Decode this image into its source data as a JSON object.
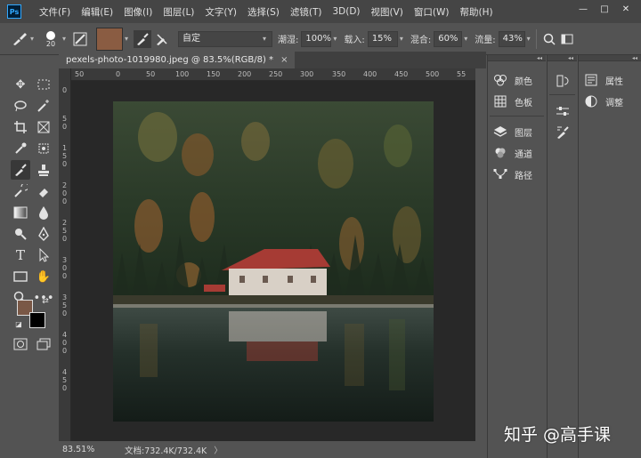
{
  "menubar": {
    "logo": "Ps",
    "items": [
      "文件(F)",
      "编辑(E)",
      "图像(I)",
      "图层(L)",
      "文字(Y)",
      "选择(S)",
      "滤镜(T)",
      "3D(D)",
      "视图(V)",
      "窗口(W)",
      "帮助(H)"
    ],
    "window_controls": [
      "—",
      "□",
      "✕"
    ]
  },
  "options": {
    "brush_size": "20",
    "brush_color": "#8a5c42",
    "mode_value": "自定",
    "opacity_label": "潮湿:",
    "opacity_value": "100%",
    "load_label": "载入:",
    "load_value": "15%",
    "mix_label": "混合:",
    "mix_value": "60%",
    "flow_label": "流量:",
    "flow_value": "43%"
  },
  "document": {
    "tab_title": "pexels-photo-1019980.jpeg @ 83.5%(RGB/8) *",
    "tab_close": "×"
  },
  "rulers": {
    "h_labels": [
      "50",
      "0",
      "50",
      "100",
      "150",
      "200",
      "250",
      "300",
      "350",
      "400",
      "450",
      "500",
      "55"
    ],
    "v_labels": [
      "0",
      "5",
      "0",
      "1",
      "5",
      "0",
      "2",
      "0",
      "0",
      "2",
      "5",
      "0",
      "3",
      "0",
      "0",
      "3",
      "5",
      "0",
      "4",
      "0",
      "0",
      "4",
      "5",
      "0"
    ]
  },
  "status": {
    "zoom": "83.51%",
    "doc_size": "文档:732.4K/732.4K",
    "chevron": "〉"
  },
  "colors": {
    "foreground": "#7a5846",
    "background": "#000000",
    "accent": "#31a8ff"
  },
  "panels": {
    "col1": [
      {
        "icon": "palette-icon",
        "label": "颜色"
      },
      {
        "icon": "swatches-icon",
        "label": "色板"
      },
      {
        "icon": "layers-icon",
        "label": "图层"
      },
      {
        "icon": "channels-icon",
        "label": "通道"
      },
      {
        "icon": "paths-icon",
        "label": "路径"
      }
    ],
    "col3": [
      {
        "icon": "properties-icon",
        "label": "属性"
      },
      {
        "icon": "adjustments-icon",
        "label": "调整"
      }
    ]
  },
  "watermark": "知乎 @高手课"
}
